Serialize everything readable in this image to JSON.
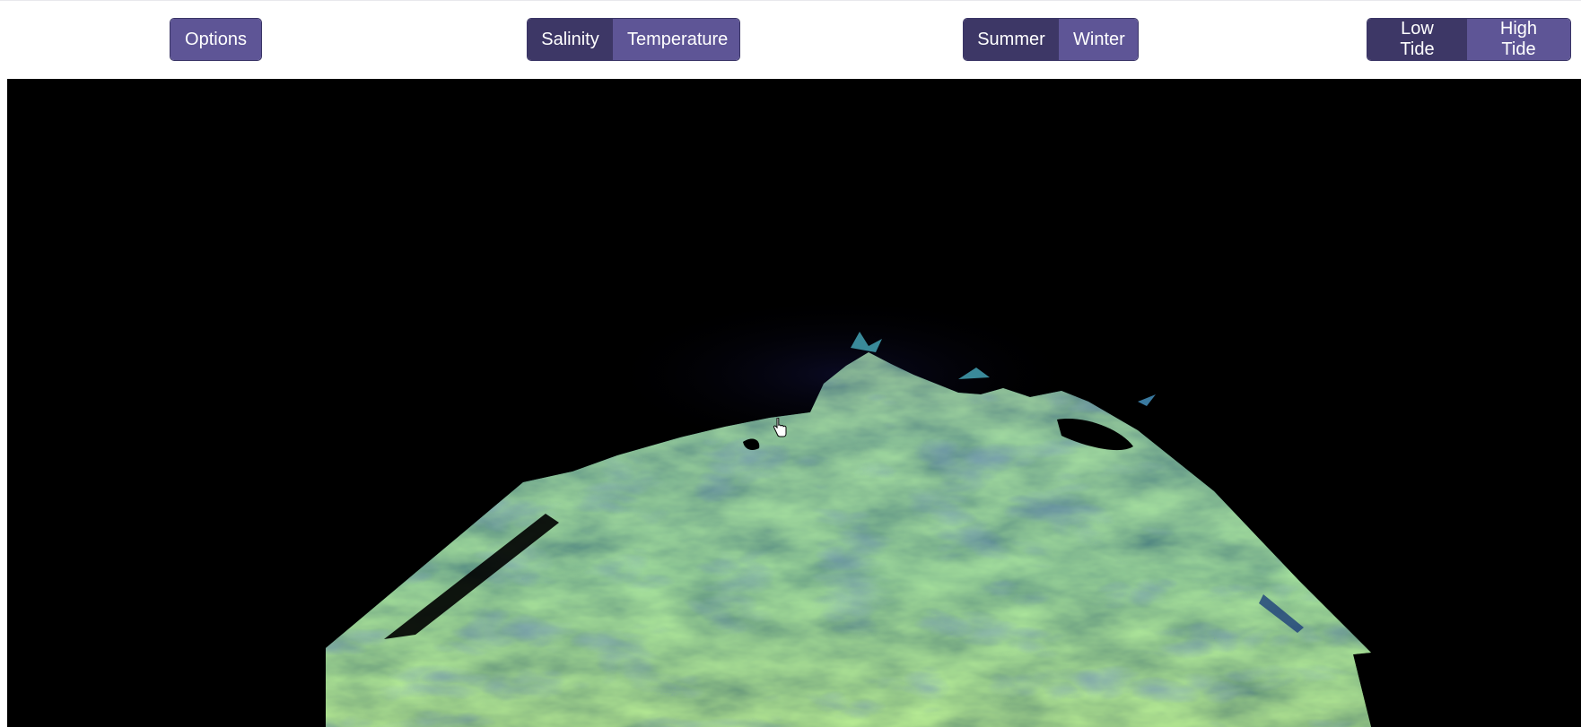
{
  "toolbar": {
    "options": {
      "label": "Options"
    },
    "variable": {
      "options": [
        "Salinity",
        "Temperature"
      ],
      "selected": "Salinity"
    },
    "season": {
      "options": [
        "Summer",
        "Winter"
      ],
      "selected": "Summer"
    },
    "tide": {
      "options": [
        "Low Tide",
        "High Tide"
      ],
      "selected": "Low Tide"
    }
  },
  "colors": {
    "button": "#5e5596",
    "button_active": "#3d3766",
    "viewport_background": "#000000",
    "surface_low": "#2a3f86",
    "surface_mid": "#3f9c9a",
    "surface_high": "#c8e35a"
  },
  "viewport": {
    "cursor_icon": "hand-pointer-icon"
  }
}
